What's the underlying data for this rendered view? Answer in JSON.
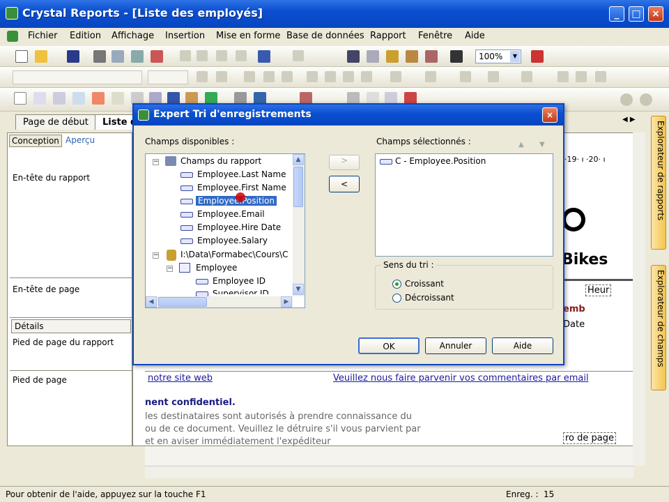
{
  "app": {
    "title": "Crystal Reports - [Liste des employés]"
  },
  "menu": [
    "Fichier",
    "Edition",
    "Affichage",
    "Insertion",
    "Mise en forme",
    "Base de données",
    "Rapport",
    "Fenêtre",
    "Aide"
  ],
  "toolbar": {
    "zoom": "100%"
  },
  "tabs": {
    "start": "Page de début",
    "current": "Liste d"
  },
  "views": {
    "design": "Conception",
    "preview": "Aperçu"
  },
  "sections": {
    "report_header": "En-tête du rapport",
    "page_header": "En-tête de page",
    "details": "Détails",
    "report_footer": "Pied de page du rapport",
    "page_footer": "Pied de page"
  },
  "report": {
    "bikes": "Bikes",
    "heure": "Heur",
    "emb": "emb",
    "date": "Date",
    "site_link": "notre site web",
    "feedback_link": "Veuillez nous faire parvenir vos commentaires par email",
    "confidential": "nent confidentiel.",
    "line1": "les destinataires sont autorisés à prendre connaissance du",
    "line2": "ou de ce document. Veuillez le détruire s'il vous parvient par",
    "line3": "et en aviser immédiatement l'expéditeur",
    "page_no": "ro de page",
    "ruler": "·19· ı ·20· ı"
  },
  "side_tabs": {
    "reports": "Explorateur de rapports",
    "fields": "Explorateur de champs"
  },
  "status": {
    "help": "Pour obtenir de l'aide, appuyez sur la touche F1",
    "records_label": "Enreg. :",
    "records": "15"
  },
  "dialog": {
    "title": "Expert Tri d'enregistrements",
    "available_label": "Champs disponibles :",
    "selected_label": "Champs sélectionnés :",
    "tree": {
      "report_fields": "Champs du rapport",
      "fields": [
        "Employee.Last Name",
        "Employee.First Name",
        "Employee.Position",
        "Employee.Email",
        "Employee.Hire Date",
        "Employee.Salary"
      ],
      "db_path": "I:\\Data\\Formabec\\Cours\\C",
      "table": "Employee",
      "table_fields": [
        "Employee ID",
        "Supervisor ID"
      ]
    },
    "add_btn": ">",
    "remove_btn": "<",
    "selected": [
      "C - Employee.Position"
    ],
    "sort_label": "Sens du tri :",
    "asc": "Croissant",
    "desc": "Décroissant",
    "ok": "OK",
    "cancel": "Annuler",
    "help": "Aide"
  }
}
